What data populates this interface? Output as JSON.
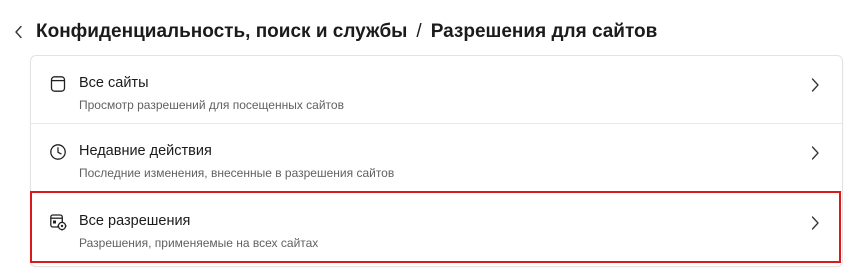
{
  "header": {
    "back_icon": "chevron-left-icon",
    "crumb_parent": "Конфиденциальность, поиск и службы",
    "separator": "/",
    "crumb_current": "Разрешения для сайтов"
  },
  "items": [
    {
      "icon": "browser-window-icon",
      "title": "Все сайты",
      "subtitle": "Просмотр разрешений для посещенных сайтов"
    },
    {
      "icon": "clock-icon",
      "title": "Недавние действия",
      "subtitle": "Последние изменения, внесенные в разрешения сайтов"
    },
    {
      "icon": "permissions-settings-icon",
      "title": "Все разрешения",
      "subtitle": "Разрешения, применяемые на всех сайтах"
    }
  ],
  "colors": {
    "highlight_border": "#d61b1b",
    "text_primary": "#1b1b1b",
    "text_secondary": "#616161"
  }
}
